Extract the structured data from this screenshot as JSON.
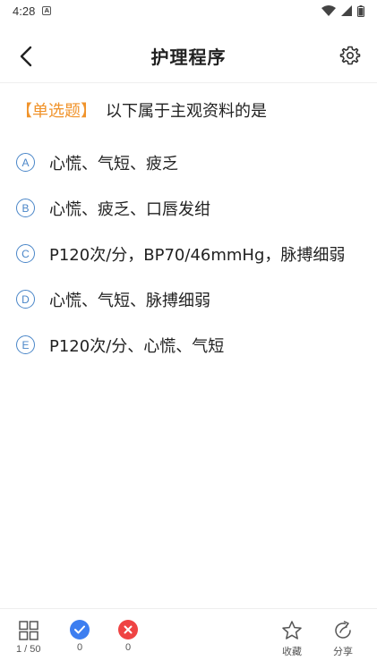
{
  "status_bar": {
    "time": "4:28",
    "indicator": "A",
    "icons": [
      "wifi-icon",
      "signal-icon",
      "battery-icon"
    ]
  },
  "header": {
    "title": "护理程序",
    "left_icon": "back-arrow-icon",
    "right_icon": "gear-icon"
  },
  "question": {
    "type_label": "【单选题】",
    "text": "以下属于主观资料的是"
  },
  "options": [
    {
      "letter": "A",
      "text": "心慌、气短、疲乏"
    },
    {
      "letter": "B",
      "text": "心慌、疲乏、口唇发绀"
    },
    {
      "letter": "C",
      "text": "P120次/分，BP70/46mmHg，脉搏细弱"
    },
    {
      "letter": "D",
      "text": "心慌、气短、脉搏细弱"
    },
    {
      "letter": "E",
      "text": "P120次/分、心慌、气短"
    }
  ],
  "bottom_bar": {
    "progress": "1 / 50",
    "correct_count": "0",
    "wrong_count": "0",
    "favorite_label": "收藏",
    "share_label": "分享"
  },
  "colors": {
    "accent": "#4a86c8",
    "question_type": "#f0932b",
    "correct": "#3d7ef0",
    "wrong": "#ef4444"
  }
}
